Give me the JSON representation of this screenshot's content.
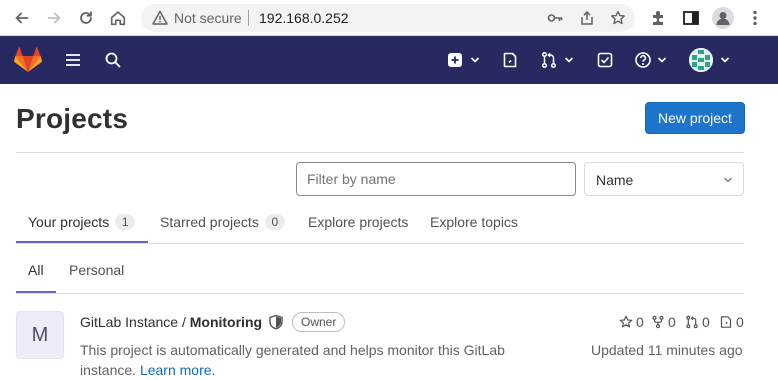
{
  "browser": {
    "security_label": "Not secure",
    "url": "192.168.0.252"
  },
  "page": {
    "title": "Projects",
    "new_project_label": "New project"
  },
  "filter": {
    "placeholder": "Filter by name",
    "sort_value": "Name"
  },
  "tabs": [
    {
      "label": "Your projects",
      "count": "1"
    },
    {
      "label": "Starred projects",
      "count": "0"
    },
    {
      "label": "Explore projects"
    },
    {
      "label": "Explore topics"
    }
  ],
  "subtabs": [
    {
      "label": "All"
    },
    {
      "label": "Personal"
    }
  ],
  "project": {
    "avatar_letter": "M",
    "namespace": "GitLab Instance / ",
    "name": "Monitoring",
    "role": "Owner",
    "description": "This project is automatically generated and helps monitor this GitLab instance.",
    "learn_more": "Learn more.",
    "stars": "0",
    "forks": "0",
    "merge_requests": "0",
    "issues": "0",
    "updated": "Updated 11 minutes ago"
  },
  "colors": {
    "nav_bg": "#292961",
    "primary_button": "#1f75cb",
    "active_tab": "#6666c4"
  }
}
